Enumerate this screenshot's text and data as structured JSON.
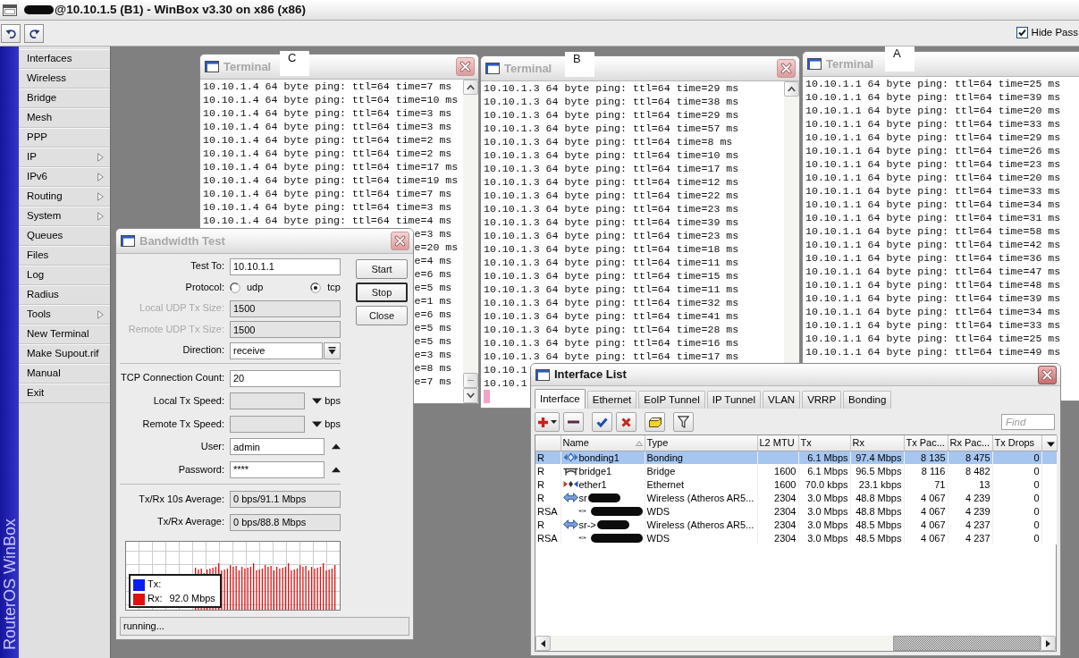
{
  "window": {
    "title": "@10.10.1.5 (B1) - WinBox v3.30 on x86 (x86)",
    "title_redacted": true
  },
  "toolbar": {
    "hide_passwords": {
      "label": "Hide Pass",
      "checked": true
    }
  },
  "sidebar": {
    "brand": "RouterOS WinBox",
    "items": [
      {
        "label": "Interfaces",
        "submenu": false
      },
      {
        "label": "Wireless",
        "submenu": false
      },
      {
        "label": "Bridge",
        "submenu": false
      },
      {
        "label": "Mesh",
        "submenu": false
      },
      {
        "label": "PPP",
        "submenu": false
      },
      {
        "label": "IP",
        "submenu": true
      },
      {
        "label": "IPv6",
        "submenu": true
      },
      {
        "label": "Routing",
        "submenu": true
      },
      {
        "label": "System",
        "submenu": true
      },
      {
        "label": "Queues",
        "submenu": false
      },
      {
        "label": "Files",
        "submenu": false
      },
      {
        "label": "Log",
        "submenu": false
      },
      {
        "label": "Radius",
        "submenu": false
      },
      {
        "label": "Tools",
        "submenu": true
      },
      {
        "label": "New Terminal",
        "submenu": false
      },
      {
        "label": "Make Supout.rif",
        "submenu": false
      },
      {
        "label": "Manual",
        "submenu": false
      },
      {
        "label": "Exit",
        "submenu": false
      }
    ]
  },
  "terminals": [
    {
      "title": "Terminal",
      "annotation": "C",
      "active": false,
      "lines": [
        "10.10.1.4 64 byte ping: ttl=64 time=7 ms",
        "10.10.1.4 64 byte ping: ttl=64 time=10 ms",
        "10.10.1.4 64 byte ping: ttl=64 time=3 ms",
        "10.10.1.4 64 byte ping: ttl=64 time=3 ms",
        "10.10.1.4 64 byte ping: ttl=64 time=2 ms",
        "10.10.1.4 64 byte ping: ttl=64 time=2 ms",
        "10.10.1.4 64 byte ping: ttl=64 time=17 ms",
        "10.10.1.4 64 byte ping: ttl=64 time=19 ms",
        "10.10.1.4 64 byte ping: ttl=64 time=7 ms",
        "10.10.1.4 64 byte ping: ttl=64 time=3 ms",
        "10.10.1.4 64 byte ping: ttl=64 time=4 ms"
      ],
      "line_ends": [
        "e=3 ms",
        "e=20 ms",
        "e=4 ms",
        "e=6 ms",
        "e=5 ms",
        "e=1 ms",
        "e=6 ms",
        "e=5 ms",
        "e=5 ms",
        "e=3 ms",
        "e=8 ms",
        "e=7 ms"
      ]
    },
    {
      "title": "Terminal",
      "annotation": "B",
      "active": false,
      "cursor": true,
      "lines": [
        "10.10.1.3 64 byte ping: ttl=64 time=29 ms",
        "10.10.1.3 64 byte ping: ttl=64 time=38 ms",
        "10.10.1.3 64 byte ping: ttl=64 time=29 ms",
        "10.10.1.3 64 byte ping: ttl=64 time=57 ms",
        "10.10.1.3 64 byte ping: ttl=64 time=8 ms",
        "10.10.1.3 64 byte ping: ttl=64 time=10 ms",
        "10.10.1.3 64 byte ping: ttl=64 time=17 ms",
        "10.10.1.3 64 byte ping: ttl=64 time=12 ms",
        "10.10.1.3 64 byte ping: ttl=64 time=22 ms",
        "10.10.1.3 64 byte ping: ttl=64 time=23 ms",
        "10.10.1.3 64 byte ping: ttl=64 time=39 ms",
        "10.10.1.3 64 byte ping: ttl=64 time=23 ms",
        "10.10.1.3 64 byte ping: ttl=64 time=18 ms",
        "10.10.1.3 64 byte ping: ttl=64 time=11 ms",
        "10.10.1.3 64 byte ping: ttl=64 time=15 ms",
        "10.10.1.3 64 byte ping: ttl=64 time=11 ms",
        "10.10.1.3 64 byte ping: ttl=64 time=32 ms",
        "10.10.1.3 64 byte ping: ttl=64 time=41 ms",
        "10.10.1.3 64 byte ping: ttl=64 time=28 ms",
        "10.10.1.3 64 byte ping: ttl=64 time=16 ms",
        "10.10.1.3 64 byte ping: ttl=64 time=17 ms",
        "10.10.1",
        "10.10.1"
      ]
    },
    {
      "title": "Terminal",
      "annotation": "A",
      "active": false,
      "lines": [
        "10.10.1.1 64 byte ping: ttl=64 time=25 ms",
        "10.10.1.1 64 byte ping: ttl=64 time=39 ms",
        "10.10.1.1 64 byte ping: ttl=64 time=20 ms",
        "10.10.1.1 64 byte ping: ttl=64 time=33 ms",
        "10.10.1.1 64 byte ping: ttl=64 time=29 ms",
        "10.10.1.1 64 byte ping: ttl=64 time=26 ms",
        "10.10.1.1 64 byte ping: ttl=64 time=23 ms",
        "10.10.1.1 64 byte ping: ttl=64 time=20 ms",
        "10.10.1.1 64 byte ping: ttl=64 time=33 ms",
        "10.10.1.1 64 byte ping: ttl=64 time=34 ms",
        "10.10.1.1 64 byte ping: ttl=64 time=31 ms",
        "10.10.1.1 64 byte ping: ttl=64 time=58 ms",
        "10.10.1.1 64 byte ping: ttl=64 time=42 ms",
        "10.10.1.1 64 byte ping: ttl=64 time=36 ms",
        "10.10.1.1 64 byte ping: ttl=64 time=47 ms",
        "10.10.1.1 64 byte ping: ttl=64 time=48 ms",
        "10.10.1.1 64 byte ping: ttl=64 time=39 ms",
        "10.10.1.1 64 byte ping: ttl=64 time=34 ms",
        "10.10.1.1 64 byte ping: ttl=64 time=33 ms",
        "10.10.1.1 64 byte ping: ttl=64 time=25 ms",
        "10.10.1.1 64 byte ping: ttl=64 time=49 ms"
      ]
    }
  ],
  "bandwidth_test": {
    "title": "Bandwidth Test",
    "active": false,
    "fields": [
      {
        "kind": "text",
        "label": "Test To:",
        "value": "10.10.1.1",
        "disabled": false
      },
      {
        "kind": "radio",
        "label": "Protocol:",
        "options": [
          {
            "label": "udp",
            "selected": false
          },
          {
            "label": "tcp",
            "selected": true
          }
        ]
      },
      {
        "kind": "text",
        "label": "Local UDP Tx Size:",
        "value": "1500",
        "disabled": true
      },
      {
        "kind": "text",
        "label": "Remote UDP Tx Size:",
        "value": "1500",
        "disabled": true
      },
      {
        "kind": "select",
        "label": "Direction:",
        "value": "receive"
      },
      {
        "kind": "separator"
      },
      {
        "kind": "text",
        "label": "TCP Connection Count:",
        "value": "20",
        "disabled": false
      },
      {
        "kind": "speed",
        "label": "Local Tx Speed:",
        "unit": "bps"
      },
      {
        "kind": "speed",
        "label": "Remote Tx Speed:",
        "unit": "bps"
      },
      {
        "kind": "collapsible",
        "label": "User:",
        "value": "admin"
      },
      {
        "kind": "collapsible",
        "label": "Password:",
        "value": "****"
      },
      {
        "kind": "separator"
      },
      {
        "kind": "readout",
        "label": "Tx/Rx 10s Average:",
        "value": "0 bps/91.1 Mbps"
      },
      {
        "kind": "readout",
        "label": "Tx/Rx Average:",
        "value": "0 bps/88.8 Mbps"
      }
    ],
    "buttons": [
      {
        "label": "Start",
        "focused": false
      },
      {
        "label": "Stop",
        "focused": true
      },
      {
        "label": "Close",
        "focused": false
      }
    ],
    "graph": {
      "legend": [
        {
          "label": "Tx:",
          "color": "#0a1ef0"
        },
        {
          "label": "Rx:",
          "value": "92.0 Mbps",
          "color": "#e01010"
        }
      ]
    },
    "status": "running..."
  },
  "interface_list": {
    "title": "Interface List",
    "active": true,
    "tabs": [
      {
        "label": "Interface",
        "selected": true
      },
      {
        "label": "Ethernet",
        "selected": false
      },
      {
        "label": "EoIP Tunnel",
        "selected": false
      },
      {
        "label": "IP Tunnel",
        "selected": false
      },
      {
        "label": "VLAN",
        "selected": false
      },
      {
        "label": "VRRP",
        "selected": false
      },
      {
        "label": "Bonding",
        "selected": false
      }
    ],
    "search": {
      "placeholder": "Find"
    },
    "columns": [
      {
        "label": "Name",
        "sorted": true
      },
      {
        "label": "Type",
        "sorted": false
      },
      {
        "label": "L2 MTU",
        "sorted": false
      },
      {
        "label": "Tx",
        "sorted": false
      },
      {
        "label": "Rx",
        "sorted": false
      },
      {
        "label": "Tx Pac...",
        "sorted": false
      },
      {
        "label": "Rx Pac...",
        "sorted": false
      },
      {
        "label": "Tx Drops",
        "sorted": false
      }
    ],
    "rows": [
      {
        "flags": "R",
        "kind": "bonding",
        "name": "bonding1",
        "redacted": false,
        "selected": true,
        "type": "Bonding",
        "tx": "6.1 Mbps",
        "rx": "97.4 Mbps",
        "tx_pac": "8 135",
        "rx_pac": "8 475",
        "tx_drops": "0"
      },
      {
        "flags": "R",
        "kind": "bridge",
        "name": "bridge1",
        "redacted": false,
        "selected": false,
        "type": "Bridge",
        "l2_mtu": "1600",
        "tx": "6.1 Mbps",
        "rx": "96.5 Mbps",
        "tx_pac": "8 116",
        "rx_pac": "8 482",
        "tx_drops": "0"
      },
      {
        "flags": "R",
        "kind": "ethernet",
        "name": "ether1",
        "redacted": false,
        "selected": false,
        "type": "Ethernet",
        "l2_mtu": "1600",
        "tx": "70.0 kbps",
        "rx": "23.1 kbps",
        "tx_pac": "71",
        "rx_pac": "13",
        "tx_drops": "0"
      },
      {
        "flags": "R",
        "kind": "wireless",
        "name": "sr",
        "redacted": true,
        "selected": false,
        "type": "Wireless (Atheros AR5...",
        "l2_mtu": "2304",
        "tx": "3.0 Mbps",
        "rx": "48.8 Mbps",
        "tx_pac": "4 067",
        "rx_pac": "4 239",
        "tx_drops": "0",
        "children": [
          {
            "flags": "RSA",
            "kind": "wds",
            "redacted": true,
            "selected": false,
            "type": "WDS",
            "l2_mtu": "2304",
            "tx": "3.0 Mbps",
            "rx": "48.8 Mbps",
            "tx_pac": "4 067",
            "rx_pac": "4 239",
            "tx_drops": "0"
          }
        ]
      },
      {
        "flags": "R",
        "kind": "wireless",
        "name": "sr->",
        "redacted": true,
        "selected": false,
        "type": "Wireless (Atheros AR5...",
        "l2_mtu": "2304",
        "tx": "3.0 Mbps",
        "rx": "48.5 Mbps",
        "tx_pac": "4 067",
        "rx_pac": "4 237",
        "tx_drops": "0",
        "children": [
          {
            "flags": "RSA",
            "kind": "wds",
            "redacted": true,
            "selected": false,
            "type": "WDS",
            "l2_mtu": "2304",
            "tx": "3.0 Mbps",
            "rx": "48.5 Mbps",
            "tx_pac": "4 067",
            "rx_pac": "4 237",
            "tx_drops": "0"
          }
        ]
      }
    ]
  }
}
